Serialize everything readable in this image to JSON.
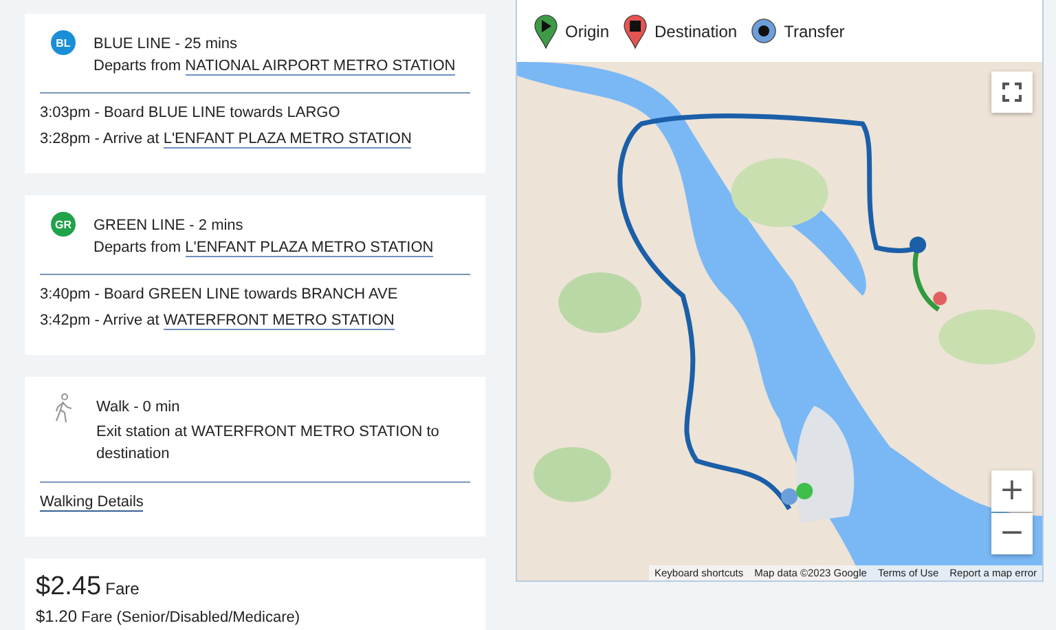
{
  "legs": [
    {
      "kind": "transit",
      "badge": "BL",
      "color": "#1a8fd8",
      "title": "BLUE LINE - 25 mins",
      "depart_prefix": "Departs from",
      "depart_station": "NATIONAL AIRPORT METRO STATION",
      "steps": [
        {
          "text": "3:03pm - Board BLUE LINE towards LARGO"
        },
        {
          "text": "3:28pm - Arrive at",
          "link": "L'ENFANT PLAZA METRO STATION"
        }
      ]
    },
    {
      "kind": "transit",
      "badge": "GR",
      "color": "#1fa24a",
      "title": "GREEN LINE - 2 mins",
      "depart_prefix": "Departs from",
      "depart_station": "L'ENFANT PLAZA METRO STATION",
      "steps": [
        {
          "text": "3:40pm - Board GREEN LINE towards BRANCH AVE"
        },
        {
          "text": "3:42pm - Arrive at",
          "link": "WATERFRONT METRO STATION"
        }
      ]
    },
    {
      "kind": "walk",
      "title": "Walk - 0 min",
      "description": "Exit station at WATERFRONT METRO STATION to destination",
      "link": "Walking Details"
    }
  ],
  "fare": {
    "price": "$2.45",
    "label": "Fare",
    "reduced_price": "$1.20",
    "reduced_label": "Fare (Senior/Disabled/Medicare)"
  },
  "map": {
    "legend": [
      {
        "kind": "origin",
        "label": "Origin",
        "color": "#3d9b47"
      },
      {
        "kind": "destination",
        "label": "Destination",
        "color": "#e65353"
      },
      {
        "kind": "transfer",
        "label": "Transfer",
        "color": "#6b9fdc"
      }
    ],
    "zoom_in": "+",
    "zoom_out": "−",
    "attribution": [
      "Keyboard shortcuts",
      "Map data ©2023 Google",
      "Terms of Use",
      "Report a map error"
    ]
  }
}
